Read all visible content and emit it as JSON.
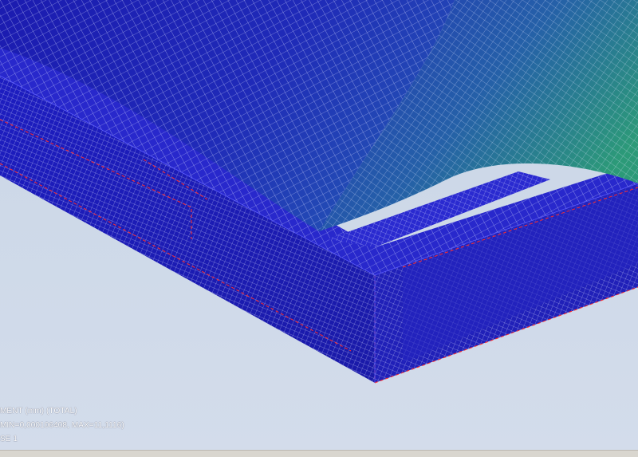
{
  "viewport": {
    "background": "#cbd7e6",
    "mesh_color": "#2828c8",
    "mesh_line_color": "#e6e6ff",
    "edge_color": "#ff2a2a",
    "surface_gradient": [
      "#1a1aa8",
      "#2b3fc0",
      "#2f7fa8",
      "#2fa070"
    ]
  },
  "legend": {
    "line1": "MENT (mm) (TOTAL)",
    "line2": "MIN=0,000106408, MAX=11,1116)",
    "line3": "SE 1"
  }
}
